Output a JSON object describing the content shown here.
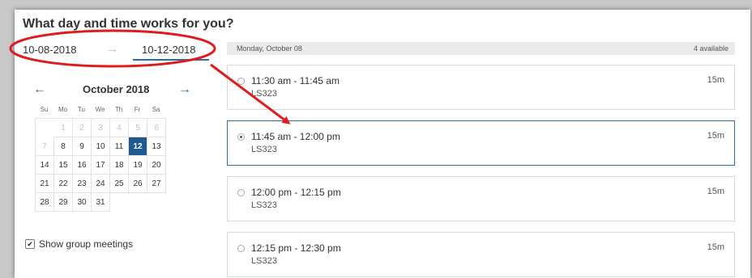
{
  "page": {
    "title": "What day and time works for you?"
  },
  "range": {
    "start": "10-08-2018",
    "end": "10-12-2018",
    "arrow": "→"
  },
  "calendar": {
    "prev": "←",
    "next": "→",
    "month": "October 2018",
    "weekdays": [
      "Su",
      "Mo",
      "Tu",
      "We",
      "Th",
      "Fr",
      "Sa"
    ],
    "days": [
      {
        "label": "",
        "state": "empty"
      },
      {
        "label": "1",
        "state": "disabled"
      },
      {
        "label": "2",
        "state": "disabled"
      },
      {
        "label": "3",
        "state": "disabled"
      },
      {
        "label": "4",
        "state": "disabled"
      },
      {
        "label": "5",
        "state": "disabled"
      },
      {
        "label": "6",
        "state": "disabled"
      },
      {
        "label": "7",
        "state": "disabled"
      },
      {
        "label": "8",
        "state": "normal"
      },
      {
        "label": "9",
        "state": "normal"
      },
      {
        "label": "10",
        "state": "normal"
      },
      {
        "label": "11",
        "state": "normal"
      },
      {
        "label": "12",
        "state": "selected"
      },
      {
        "label": "13",
        "state": "normal"
      },
      {
        "label": "14",
        "state": "normal"
      },
      {
        "label": "15",
        "state": "normal"
      },
      {
        "label": "16",
        "state": "normal"
      },
      {
        "label": "17",
        "state": "normal"
      },
      {
        "label": "18",
        "state": "normal"
      },
      {
        "label": "19",
        "state": "normal"
      },
      {
        "label": "20",
        "state": "normal"
      },
      {
        "label": "21",
        "state": "normal"
      },
      {
        "label": "22",
        "state": "normal"
      },
      {
        "label": "23",
        "state": "normal"
      },
      {
        "label": "24",
        "state": "normal"
      },
      {
        "label": "25",
        "state": "normal"
      },
      {
        "label": "26",
        "state": "normal"
      },
      {
        "label": "27",
        "state": "normal"
      },
      {
        "label": "28",
        "state": "normal"
      },
      {
        "label": "29",
        "state": "normal"
      },
      {
        "label": "30",
        "state": "normal"
      },
      {
        "label": "31",
        "state": "normal"
      }
    ]
  },
  "group_meetings": {
    "label": "Show group meetings",
    "checked": true,
    "check_glyph": "✔"
  },
  "day_header": {
    "date": "Monday, October 08",
    "count": "4 available"
  },
  "slots": [
    {
      "time": "11:30 am - 11:45 am",
      "room": "LS323",
      "duration": "15m",
      "selected": false
    },
    {
      "time": "11:45 am - 12:00 pm",
      "room": "LS323",
      "duration": "15m",
      "selected": true
    },
    {
      "time": "12:00 pm - 12:15 pm",
      "room": "LS323",
      "duration": "15m",
      "selected": false
    },
    {
      "time": "12:15 pm - 12:30 pm",
      "room": "LS323",
      "duration": "15m",
      "selected": false
    }
  ],
  "colors": {
    "accent": "#2a6ea6",
    "selected_day": "#1f5b92",
    "annotation": "#e01b1b"
  }
}
